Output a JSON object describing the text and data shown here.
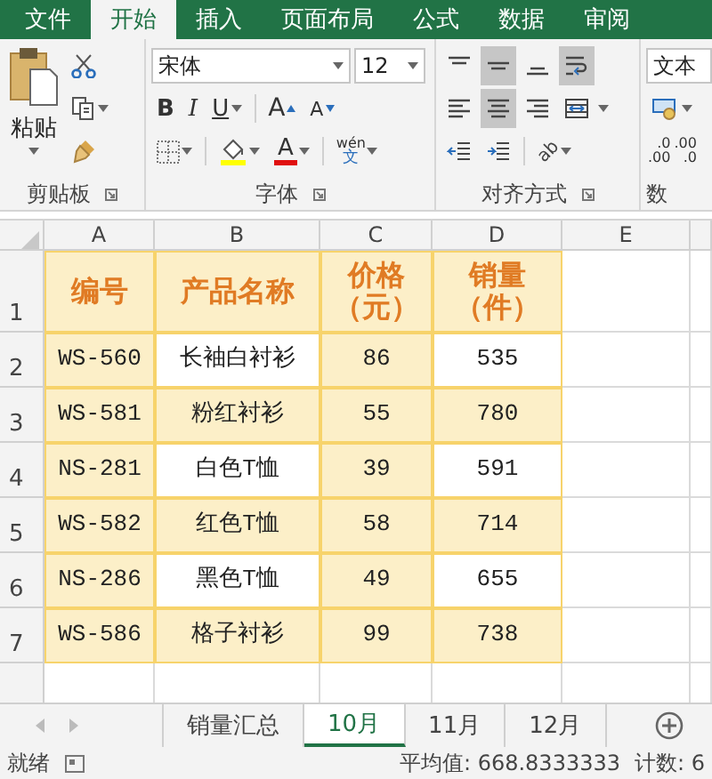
{
  "ribbon_tabs": [
    {
      "label": "文件",
      "selected": false
    },
    {
      "label": "开始",
      "selected": true
    },
    {
      "label": "插入",
      "selected": false
    },
    {
      "label": "页面布局",
      "selected": false
    },
    {
      "label": "公式",
      "selected": false
    },
    {
      "label": "数据",
      "selected": false
    },
    {
      "label": "审阅",
      "selected": false
    }
  ],
  "clipboard": {
    "paste_label": "粘贴",
    "group_label": "剪贴板"
  },
  "font": {
    "name": "宋体",
    "size": "12",
    "bold": "B",
    "italic": "I",
    "underline": "U",
    "grow": "A",
    "shrink": "A",
    "font_color": "A",
    "phonetic_top": "wén",
    "phonetic_bottom": "文",
    "group_label": "字体"
  },
  "alignment": {
    "buttons": [
      {
        "kind": "top",
        "selected": false
      },
      {
        "kind": "middle",
        "selected": true
      },
      {
        "kind": "bottom",
        "selected": false
      },
      {
        "kind": "wrap",
        "selected": true
      },
      {
        "kind": "left",
        "selected": false
      },
      {
        "kind": "center",
        "selected": true
      },
      {
        "kind": "right",
        "selected": false
      },
      {
        "kind": "merge",
        "selected": false
      },
      {
        "kind": "outdent",
        "selected": false
      },
      {
        "kind": "indent",
        "selected": false
      }
    ],
    "orientation": "ab",
    "group_label": "对齐方式"
  },
  "number": {
    "format": "文本",
    "decimals": [
      {
        "top": ".0",
        "bottom": ".00"
      },
      {
        "top": ".00",
        "bottom": ".0"
      }
    ],
    "group_label": "数"
  },
  "columns": [
    "A",
    "B",
    "C",
    "D",
    "E"
  ],
  "rows": [
    {
      "number": "1",
      "kind": "header",
      "cells": [
        {
          "text": "编号",
          "shaded": true
        },
        {
          "text": "产品名称",
          "shaded": true
        },
        {
          "text": "价格（元）",
          "shaded": true
        },
        {
          "text": "销量（件）",
          "shaded": true
        }
      ]
    },
    {
      "number": "2",
      "kind": "data",
      "cells": [
        {
          "text": "WS-560",
          "shaded": true
        },
        {
          "text": "长袖白衬衫",
          "shaded": false
        },
        {
          "text": "86",
          "shaded": true
        },
        {
          "text": "535",
          "shaded": false
        }
      ]
    },
    {
      "number": "3",
      "kind": "data",
      "cells": [
        {
          "text": "WS-581",
          "shaded": true
        },
        {
          "text": "粉红衬衫",
          "shaded": true
        },
        {
          "text": "55",
          "shaded": true
        },
        {
          "text": "780",
          "shaded": true
        }
      ]
    },
    {
      "number": "4",
      "kind": "data",
      "cells": [
        {
          "text": "NS-281",
          "shaded": true
        },
        {
          "text": "白色T恤",
          "shaded": false
        },
        {
          "text": "39",
          "shaded": true
        },
        {
          "text": "591",
          "shaded": false
        }
      ]
    },
    {
      "number": "5",
      "kind": "data",
      "cells": [
        {
          "text": "WS-582",
          "shaded": true
        },
        {
          "text": "红色T恤",
          "shaded": true
        },
        {
          "text": "58",
          "shaded": true
        },
        {
          "text": "714",
          "shaded": true
        }
      ]
    },
    {
      "number": "6",
      "kind": "data",
      "cells": [
        {
          "text": "NS-286",
          "shaded": true
        },
        {
          "text": "黑色T恤",
          "shaded": false
        },
        {
          "text": "49",
          "shaded": true
        },
        {
          "text": "655",
          "shaded": false
        }
      ]
    },
    {
      "number": "7",
      "kind": "data",
      "cells": [
        {
          "text": "WS-586",
          "shaded": true
        },
        {
          "text": "格子衬衫",
          "shaded": true
        },
        {
          "text": "99",
          "shaded": true
        },
        {
          "text": "738",
          "shaded": true
        }
      ]
    }
  ],
  "sheets": [
    {
      "label": "销量汇总",
      "selected": false
    },
    {
      "label": "10月",
      "selected": true
    },
    {
      "label": "11月",
      "selected": false
    },
    {
      "label": "12月",
      "selected": false
    }
  ],
  "status_bar": {
    "ready": "就绪",
    "average": "平均值: 668.8333333",
    "count": "计数: 6"
  }
}
